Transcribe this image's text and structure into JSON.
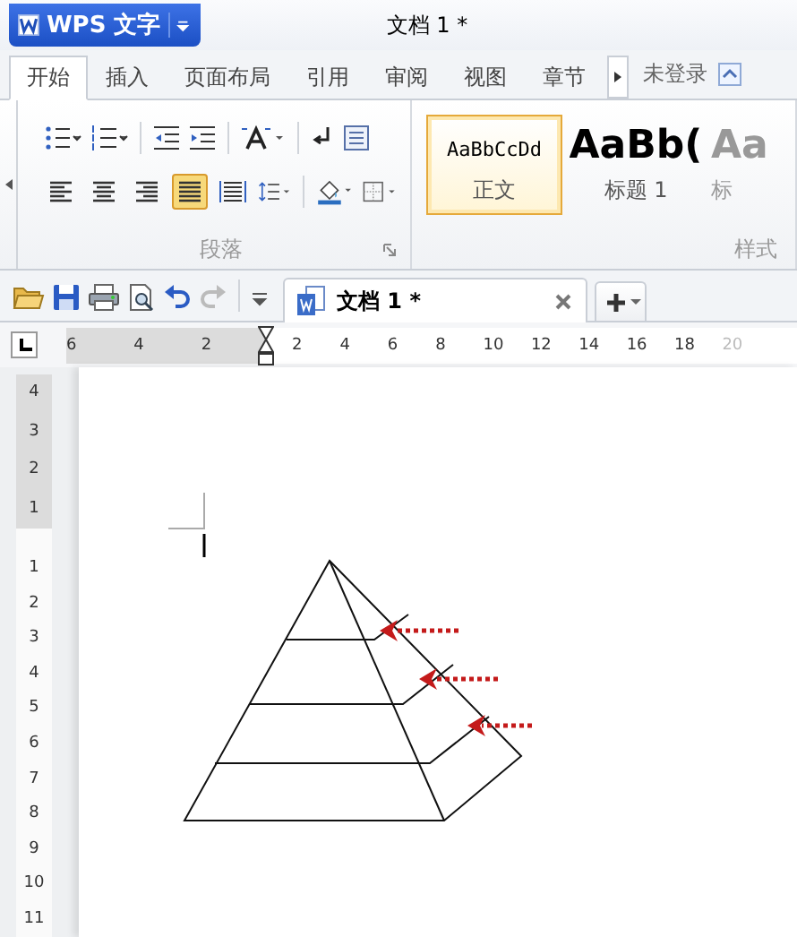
{
  "app_button": {
    "label": "WPS 文字"
  },
  "window": {
    "title": "文档 1 *"
  },
  "tabs": [
    {
      "label": "开始",
      "selected": true
    },
    {
      "label": "插入",
      "selected": false
    },
    {
      "label": "页面布局",
      "selected": false
    },
    {
      "label": "引用",
      "selected": false
    },
    {
      "label": "审阅",
      "selected": false
    },
    {
      "label": "视图",
      "selected": false
    },
    {
      "label": "章节",
      "selected": false
    }
  ],
  "account": {
    "label": "未登录"
  },
  "paragraph_group": {
    "label": "段落",
    "alignments": [
      {
        "kind": "left",
        "selected": false
      },
      {
        "kind": "center",
        "selected": false
      },
      {
        "kind": "right",
        "selected": false
      },
      {
        "kind": "justify",
        "selected": true
      },
      {
        "kind": "distributed",
        "selected": false
      }
    ]
  },
  "styles_group": {
    "label": "样式",
    "items": [
      {
        "preview": "AaBbCcDd",
        "label": "正文",
        "selected": true
      },
      {
        "preview": "AaBb(",
        "label": "标题 1",
        "selected": false
      },
      {
        "preview": "Aa",
        "label": "标",
        "selected": false
      }
    ]
  },
  "document_tab": {
    "title": "文档 1 *"
  },
  "ruler": {
    "left_ticks": [
      "6",
      "4",
      "2"
    ],
    "right_ticks": [
      "2",
      "4",
      "6",
      "8",
      "10",
      "12",
      "14",
      "16",
      "18",
      "20"
    ]
  },
  "vertical_ruler": {
    "top_ticks": [
      "4",
      "3",
      "2",
      "1"
    ],
    "bottom_ticks": [
      "1",
      "2",
      "3",
      "4",
      "5",
      "6",
      "7",
      "8",
      "9",
      "10",
      "11"
    ]
  }
}
